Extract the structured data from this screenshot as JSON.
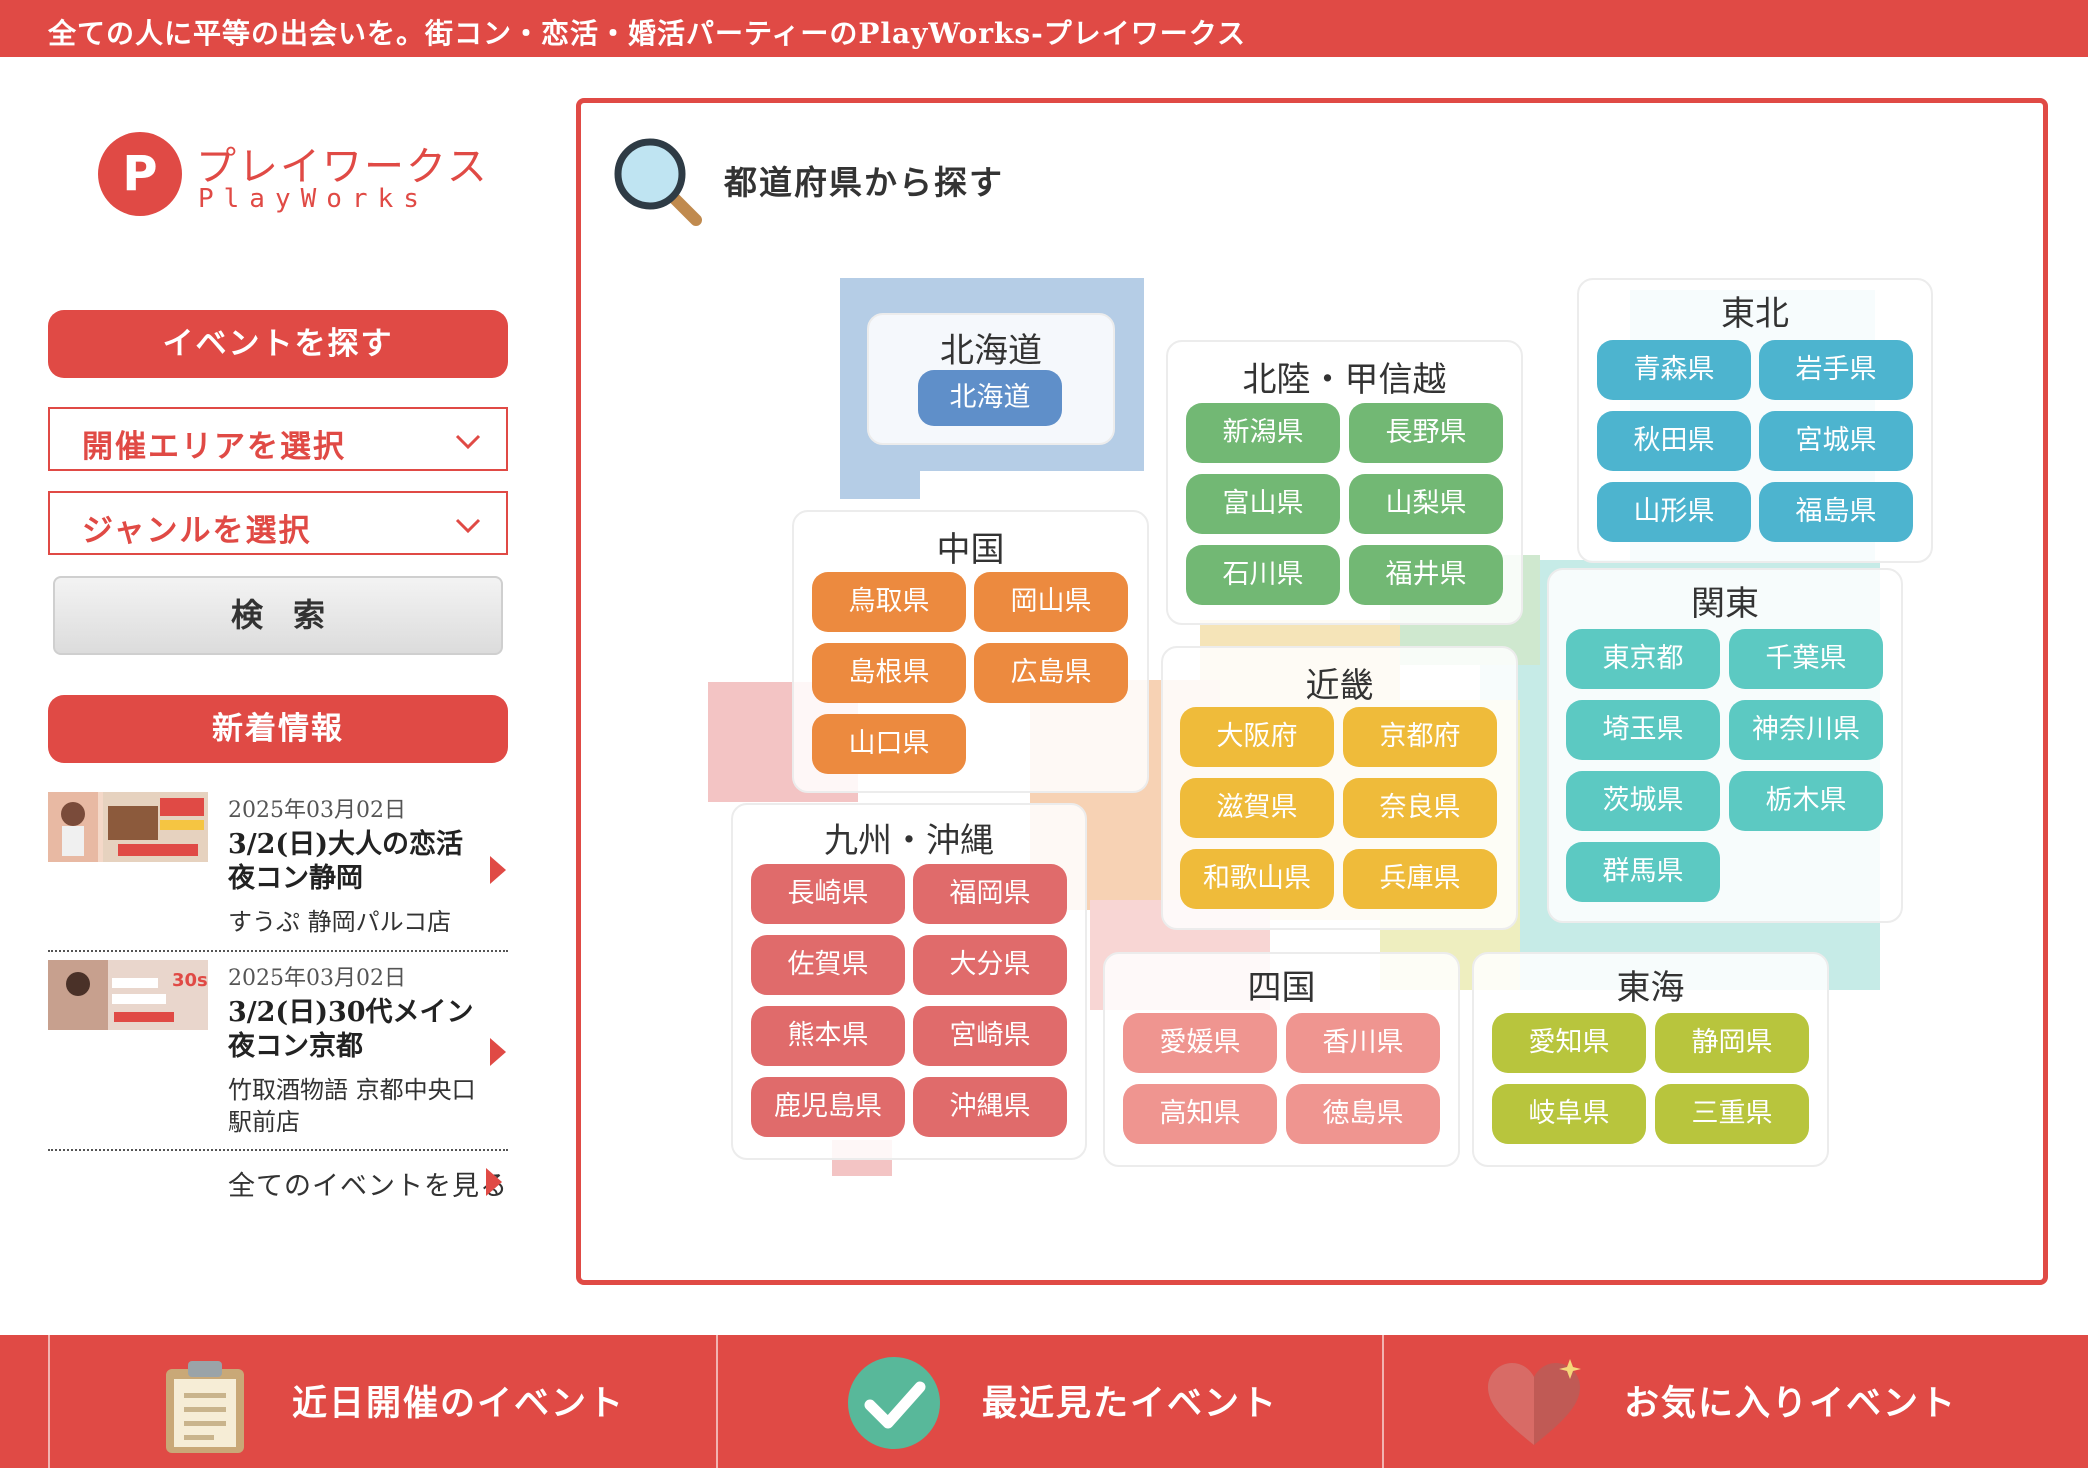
{
  "banner": {
    "text": "全ての人に平等の出会いを。街コン・恋活・婚活パーティーのPlayWorks-プレイワークス"
  },
  "logo": {
    "jp": "プレイワークス",
    "en": "PlayWorks",
    "mark": "P"
  },
  "sidebar": {
    "find_events_label": "イベントを探す",
    "area_select_label": "開催エリアを選択",
    "genre_select_label": "ジャンルを選択",
    "search_label": "検索",
    "news_header": "新着情報",
    "news": [
      {
        "date": "2025年03月02日",
        "title": "3/2(日)大人の恋活夜コン静岡",
        "venue": "すうぷ 静岡パルコ店"
      },
      {
        "date": "2025年03月02日",
        "title": "3/2(日)30代メイン夜コン京都",
        "venue": "竹取酒物語 京都中央口駅前店"
      }
    ],
    "all_events_label": "全てのイベントを見る"
  },
  "map": {
    "title": "都道府県から探す",
    "icon": "magnifier-icon",
    "regions": [
      {
        "name": "北海道",
        "color": "#5f8fc9",
        "prefs": [
          "北海道"
        ]
      },
      {
        "name": "北陸・甲信越",
        "color": "#72b874",
        "prefs": [
          "新潟県",
          "長野県",
          "富山県",
          "山梨県",
          "石川県",
          "福井県"
        ]
      },
      {
        "name": "東北",
        "color": "#4db4cf",
        "prefs": [
          "青森県",
          "岩手県",
          "秋田県",
          "宮城県",
          "山形県",
          "福島県"
        ]
      },
      {
        "name": "中国",
        "color": "#ec8a3f",
        "prefs": [
          "鳥取県",
          "岡山県",
          "島根県",
          "広島県",
          "山口県"
        ]
      },
      {
        "name": "関東",
        "color": "#5cc9c2",
        "prefs": [
          "東京都",
          "千葉県",
          "埼玉県",
          "神奈川県",
          "茨城県",
          "栃木県",
          "群馬県"
        ]
      },
      {
        "name": "近畿",
        "color": "#efbb3a",
        "prefs": [
          "大阪府",
          "京都府",
          "滋賀県",
          "奈良県",
          "和歌山県",
          "兵庫県"
        ]
      },
      {
        "name": "九州・沖縄",
        "color": "#e06b6b",
        "prefs": [
          "長崎県",
          "福岡県",
          "佐賀県",
          "大分県",
          "熊本県",
          "宮崎県",
          "鹿児島県",
          "沖縄県"
        ]
      },
      {
        "name": "四国",
        "color": "#ef9590",
        "prefs": [
          "愛媛県",
          "香川県",
          "高知県",
          "徳島県"
        ]
      },
      {
        "name": "東海",
        "color": "#b8c53d",
        "prefs": [
          "愛知県",
          "静岡県",
          "岐阜県",
          "三重県"
        ]
      }
    ]
  },
  "bottom_nav": [
    {
      "label": "近日開催のイベント",
      "icon": "clipboard-icon"
    },
    {
      "label": "最近見たイベント",
      "icon": "checkmark-icon"
    },
    {
      "label": "お気に入りイベント",
      "icon": "heart-icon"
    }
  ]
}
